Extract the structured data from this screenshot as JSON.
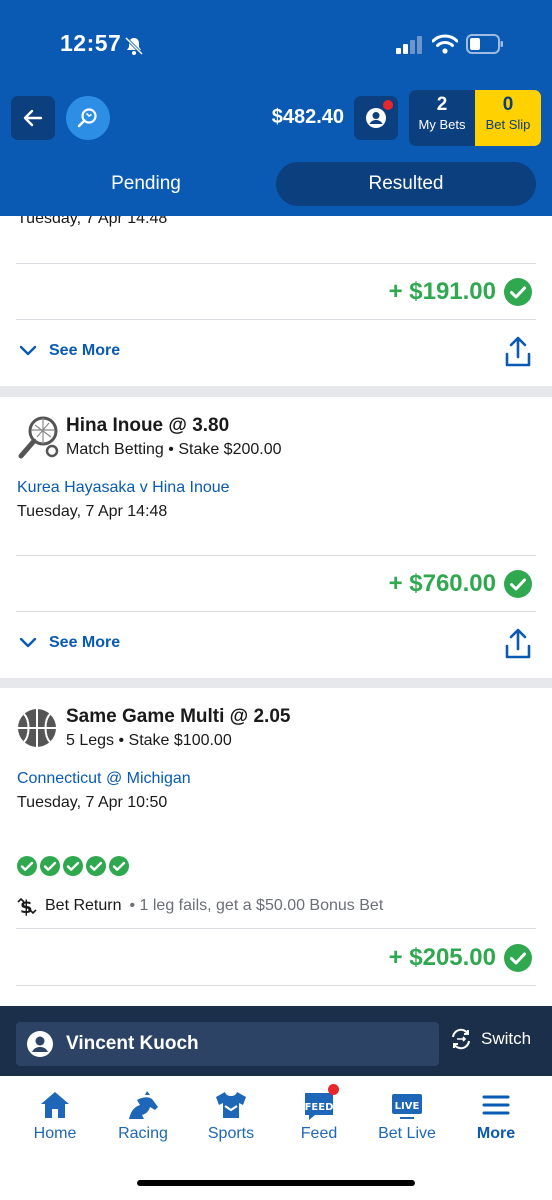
{
  "status": {
    "time": "12:57"
  },
  "header": {
    "balance": "$482.40",
    "my_bets_count": "2",
    "my_bets_label": "My Bets",
    "bet_slip_count": "0",
    "bet_slip_label": "Bet Slip"
  },
  "tabs": {
    "pending": "Pending",
    "resulted": "Resulted"
  },
  "bets": [
    {
      "date": "Tuesday, 7 Apr 14:48",
      "return": "+ $191.00",
      "see_more": "See More"
    },
    {
      "sport_icon": "tennis-icon",
      "title": "Hina Inoue @ 3.80",
      "subtitle": "Match Betting • Stake $200.00",
      "event": "Kurea Hayasaka v Hina Inoue",
      "date": "Tuesday, 7 Apr 14:48",
      "return": "+ $760.00",
      "see_more": "See More"
    },
    {
      "sport_icon": "basketball-icon",
      "title": "Same Game Multi @ 2.05",
      "subtitle": "5 Legs • Stake $100.00",
      "event": "Connecticut @ Michigan",
      "date": "Tuesday, 7 Apr 10:50",
      "legs_won": 5,
      "bet_return_label": "Bet Return",
      "bet_return_desc": "• 1 leg fails, get a $50.00 Bonus Bet",
      "return": "+ $205.00"
    }
  ],
  "user_bar": {
    "name": "Vincent Kuoch",
    "switch_label": "Switch"
  },
  "bottom_nav": [
    {
      "label": "Home",
      "icon": "home-icon"
    },
    {
      "label": "Racing",
      "icon": "horse-icon"
    },
    {
      "label": "Sports",
      "icon": "jersey-icon"
    },
    {
      "label": "Feed",
      "icon": "feed-icon"
    },
    {
      "label": "Bet Live",
      "icon": "live-icon"
    },
    {
      "label": "More",
      "icon": "menu-icon"
    }
  ],
  "colors": {
    "brand_blue": "#0a5ab4",
    "win_green": "#2fa84f",
    "bet_slip_yellow": "#ffd100"
  }
}
